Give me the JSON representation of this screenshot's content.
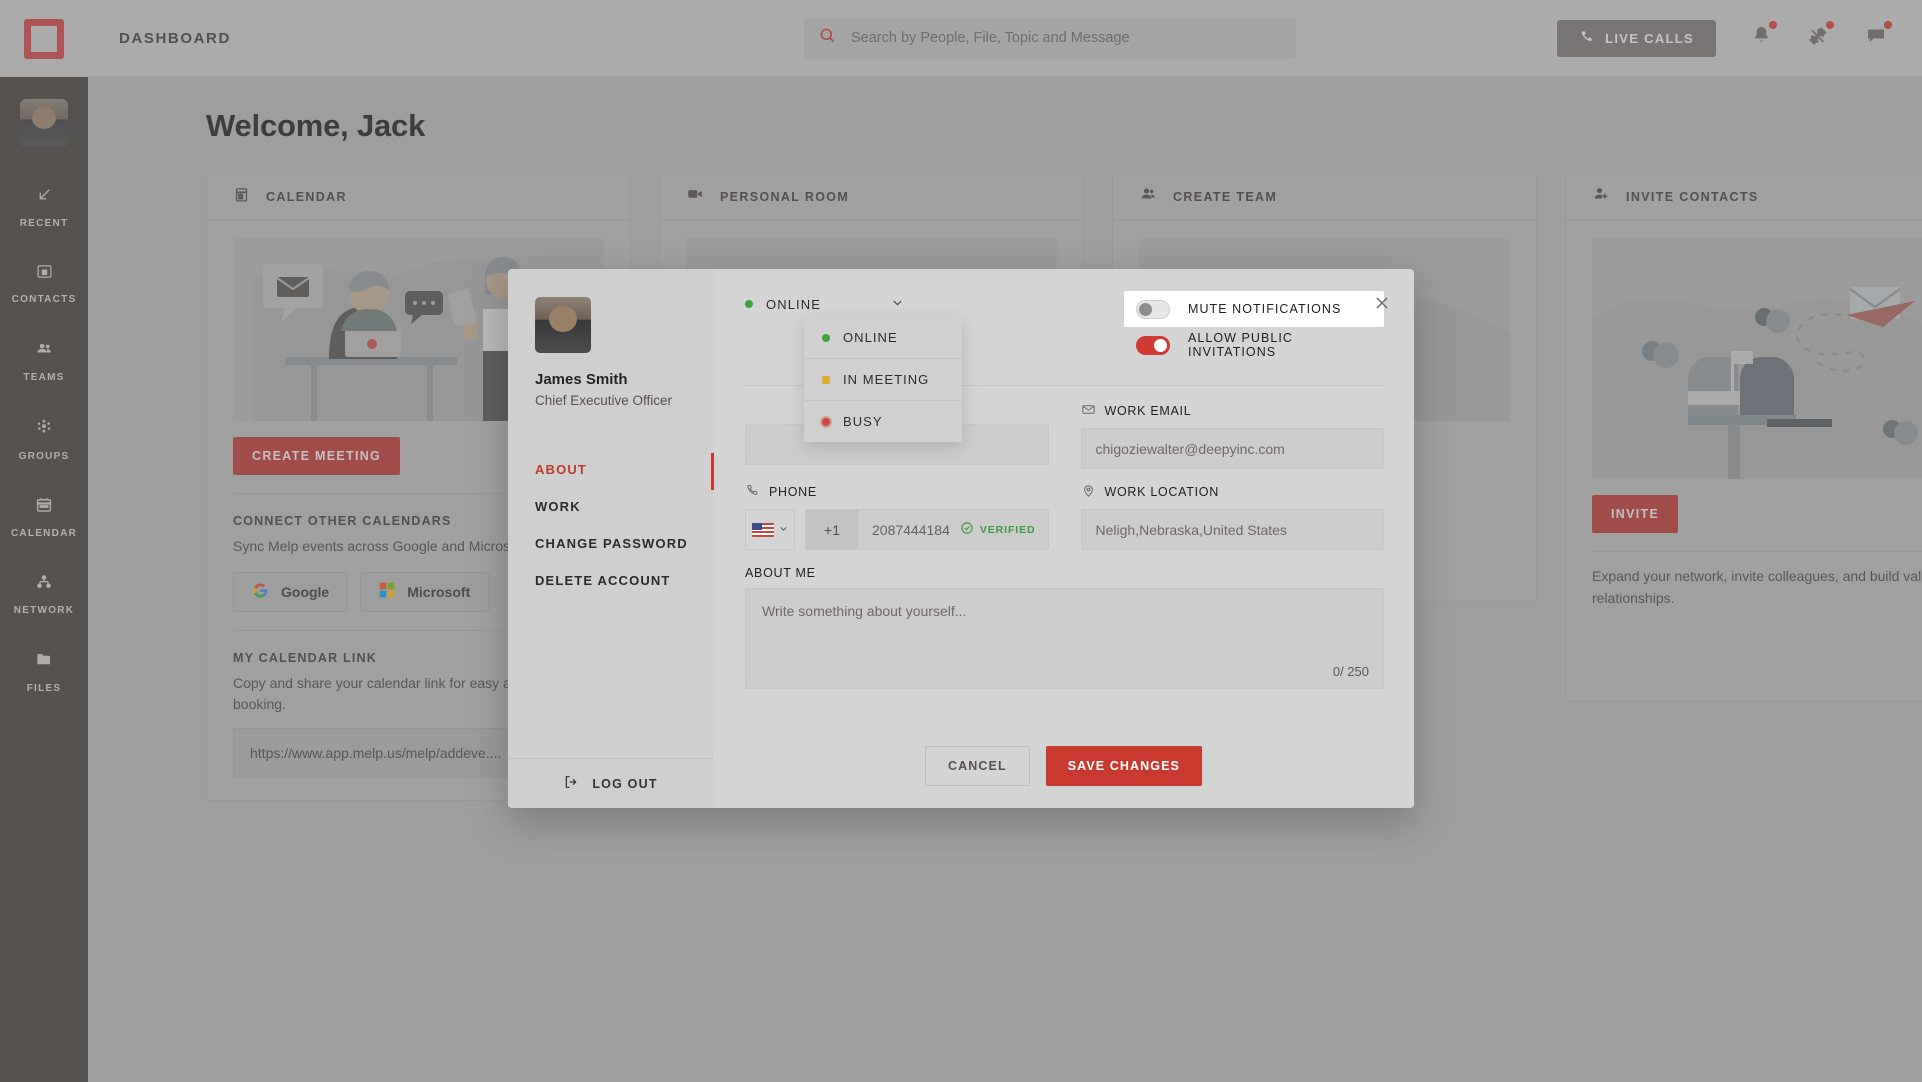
{
  "app": {
    "brand_icon": "melp-logo-icon",
    "header_title": "DASHBOARD",
    "welcome": "Welcome, Jack"
  },
  "search": {
    "icon": "search-icon",
    "placeholder": "Search by People, File, Topic and Message",
    "value": ""
  },
  "header_actions": {
    "live_calls_label": "LIVE CALLS",
    "live_calls_icon": "phone-icon",
    "notifications_icon": "bell-icon",
    "pinned_icon": "pin-icon",
    "messages_icon": "chat-icon",
    "badge_color": "#d23b34"
  },
  "sidebar": {
    "avatar": "user-avatar",
    "items": [
      {
        "label": "RECENT",
        "icon": "arrow-down-left-icon"
      },
      {
        "label": "CONTACTS",
        "icon": "contacts-icon"
      },
      {
        "label": "TEAMS",
        "icon": "teams-icon"
      },
      {
        "label": "GROUPS",
        "icon": "groups-icon"
      },
      {
        "label": "CALENDAR",
        "icon": "calendar-icon"
      },
      {
        "label": "NETWORK",
        "icon": "network-icon"
      },
      {
        "label": "FILES",
        "icon": "folder-icon"
      }
    ]
  },
  "cards": {
    "calendar": {
      "title": "CALENDAR",
      "icon": "calendar-icon",
      "create_meeting_label": "CREATE MEETING",
      "connect_title": "CONNECT OTHER CALENDARS",
      "connect_text": "Sync Melp events across Google and Microsoft Calendars.",
      "google_label": "Google",
      "microsoft_label": "Microsoft",
      "link_title": "MY CALENDAR LINK",
      "link_text": "Copy and share your calendar link for easy appointment booking.",
      "link_value": "https://www.app.melp.us/melp/addeve....",
      "link_icon": "link-icon"
    },
    "personal_room": {
      "title": "PERSONAL ROOM",
      "icon": "video-camera-icon"
    },
    "create_team": {
      "title": "CREATE TEAM",
      "icon": "user-group-icon"
    },
    "invite": {
      "title": "INVITE CONTACTS",
      "icon": "add-user-icon",
      "button_label": "INVITE",
      "text": "Expand your network, invite colleagues, and build valuable relationships."
    }
  },
  "modal": {
    "close_icon": "close-icon",
    "profile": {
      "avatar": "profile-avatar",
      "name": "James Smith",
      "role": "Chief Executive Officer"
    },
    "menu": [
      {
        "label": "ABOUT",
        "active": true
      },
      {
        "label": "WORK",
        "active": false
      },
      {
        "label": "CHANGE PASSWORD",
        "active": false
      },
      {
        "label": "DELETE ACCOUNT",
        "active": false
      }
    ],
    "logout_label": "LOG OUT",
    "logout_icon": "logout-icon",
    "status": {
      "selected": "ONLINE",
      "caret_icon": "chevron-down-icon",
      "open": true,
      "options": [
        {
          "label": "ONLINE",
          "dot": "green"
        },
        {
          "label": "IN MEETING",
          "dot": "yellow"
        },
        {
          "label": "BUSY",
          "dot": "red"
        }
      ]
    },
    "toggles": [
      {
        "label": "MUTE NOTIFICATIONS",
        "on": false,
        "highlighted": true
      },
      {
        "label": "ALLOW PUBLIC INVITATIONS",
        "on": true,
        "highlighted": false
      }
    ],
    "fields": {
      "work_email_label": "WORK EMAIL",
      "work_email_icon": "envelope-icon",
      "work_email_value": "chigoziewalter@deepyinc.com",
      "phone_label": "PHONE",
      "phone_icon": "phone-icon",
      "phone_country_flag": "us-flag-icon",
      "phone_code": "+1",
      "phone_value": "2087444184",
      "phone_verified_label": "VERIFIED",
      "phone_verified_icon": "check-circle-icon",
      "work_location_label": "WORK LOCATION",
      "work_location_icon": "pin-location-icon",
      "work_location_value": "Neligh,Nebraska,United States",
      "about_label": "ABOUT ME",
      "about_placeholder": "Write something about yourself...",
      "about_counter": "0/ 250"
    },
    "actions": {
      "cancel_label": "CANCEL",
      "save_label": "SAVE CHANGES"
    }
  },
  "colors": {
    "accent": "#c8392f",
    "online": "#3fa23f",
    "verified": "#3f9c42"
  }
}
